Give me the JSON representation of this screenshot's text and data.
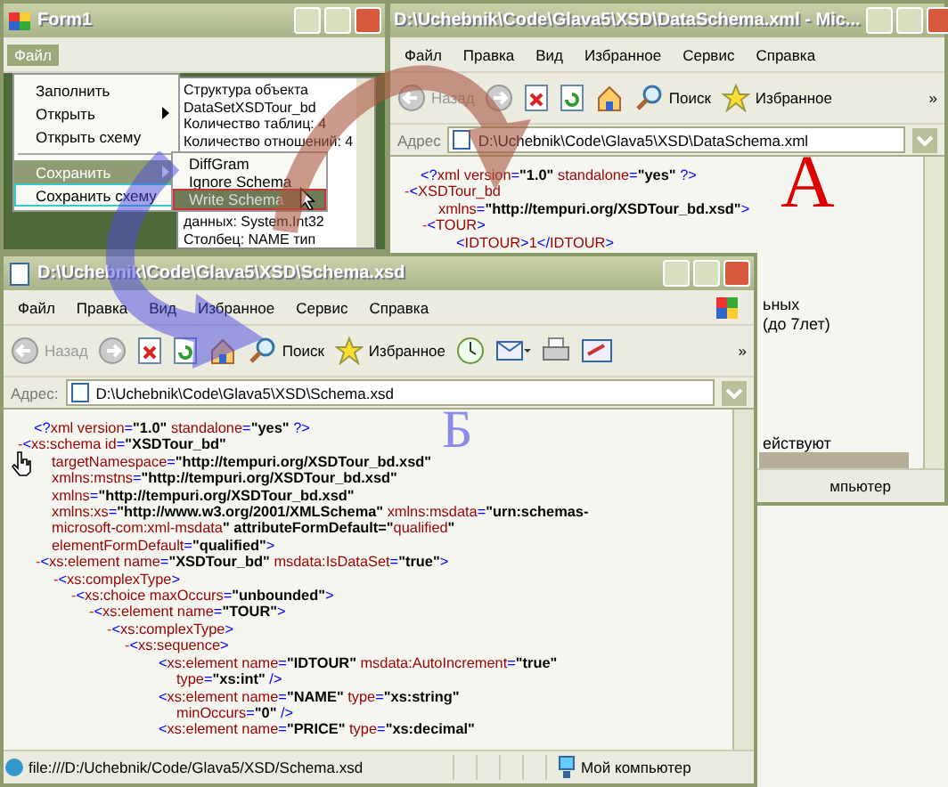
{
  "form1": {
    "title": "Form1",
    "menu": [
      {
        "label": "Файл",
        "selected": true
      }
    ],
    "dropdown": [
      {
        "label": "Заполнить",
        "selected": false,
        "submenu": false,
        "focused": false
      },
      {
        "label": "Открыть",
        "selected": false,
        "submenu": true,
        "focused": false
      },
      {
        "label": "Открыть схему",
        "selected": false,
        "submenu": false,
        "focused": false
      },
      {
        "label": "Сохранить",
        "selected": true,
        "submenu": true,
        "focused": false
      },
      {
        "label": "Сохранить схему",
        "selected": false,
        "submenu": false,
        "focused": true
      }
    ],
    "submenu": [
      {
        "label": "DiffGram",
        "selected": false
      },
      {
        "label": "Ignore Schema",
        "selected": false
      },
      {
        "label": "Write Schema",
        "selected": true
      }
    ],
    "textbox": [
      "Структура объекта",
      "DataSetXSDTour_bd",
      "Количество таблиц: 4",
      "Количество отношений: 4",
      "данных: System.Int32",
      "Столбец: NAME тип"
    ]
  },
  "window_a": {
    "title": "D:\\Uchebnik\\Code\\Glava5\\XSD\\DataSchema.xml - Mic...",
    "menu": [
      "Файл",
      "Правка",
      "Вид",
      "Избранное",
      "Сервис",
      "Справка"
    ],
    "toolbar": {
      "back": "Назад",
      "search": "Поиск",
      "favorites": "Избранное",
      "more": "»"
    },
    "address_label": "Адрес",
    "address": "D:\\Uchebnik\\Code\\Glava5\\XSD\\DataSchema.xml",
    "xml": [
      {
        "lines": [
          "<?xml version=\"1.0\" standalone=\"yes\" ?>"
        ]
      },
      {
        "toggle": "-",
        "lines": [
          "<XSDTour_bd",
          "xmlns=\"http://tempuri.org/XSDTour_bd.xsd\">"
        ],
        "children": [
          {
            "toggle": "-",
            "lines": [
              "<TOUR>"
            ],
            "children": [
              {
                "lines": [
                  "<IDTOUR>1</IDTOUR>"
                ]
              }
            ]
          }
        ]
      }
    ],
    "fragments": [
      "ьных",
      "(до 7лет)",
      "ействуют"
    ],
    "status": "мпьютер",
    "marker": "А"
  },
  "window_b": {
    "title": "D:\\Uchebnik\\Code\\Glava5\\XSD\\Schema.xsd",
    "menu": [
      "Файл",
      "Правка",
      "Вид",
      "Избранное",
      "Сервис",
      "Справка"
    ],
    "toolbar": {
      "back": "Назад",
      "search": "Поиск",
      "favorites": "Избранное",
      "more": "»"
    },
    "address_label": "Адрес:",
    "address": "D:\\Uchebnik\\Code\\Glava5\\XSD\\Schema.xsd",
    "xml": [
      {
        "lines": [
          "<?xml version=\"1.0\" standalone=\"yes\" ?>"
        ]
      },
      {
        "toggle": "-",
        "lines": [
          "<xs:schema id=\"XSDTour_bd\"",
          "targetNamespace=\"http://tempuri.org/XSDTour_bd.xsd\"",
          "xmlns:mstns=\"http://tempuri.org/XSDTour_bd.xsd\"",
          "xmlns=\"http://tempuri.org/XSDTour_bd.xsd\"",
          "xmlns:xs=\"http://www.w3.org/2001/XMLSchema\" xmlns:msdata=\"urn:schemas-",
          "microsoft-com:xml-msdata\" attributeFormDefault=\"qualified\"",
          "elementFormDefault=\"qualified\">"
        ],
        "children": [
          {
            "toggle": "-",
            "lines": [
              "<xs:element name=\"XSDTour_bd\" msdata:IsDataSet=\"true\">"
            ],
            "children": [
              {
                "toggle": "-",
                "lines": [
                  "<xs:complexType>"
                ],
                "children": [
                  {
                    "toggle": "-",
                    "lines": [
                      "<xs:choice maxOccurs=\"unbounded\">"
                    ],
                    "children": [
                      {
                        "toggle": "-",
                        "lines": [
                          "<xs:element name=\"TOUR\">"
                        ],
                        "children": [
                          {
                            "toggle": "-",
                            "lines": [
                              "<xs:complexType>"
                            ],
                            "children": [
                              {
                                "toggle": "-",
                                "lines": [
                                  "<xs:sequence>"
                                ],
                                "children": [
                                  {
                                    "lines": [
                                      "<xs:element name=\"IDTOUR\" msdata:AutoIncrement=\"true\"",
                                      "type=\"xs:int\" />"
                                    ]
                                  },
                                  {
                                    "lines": [
                                      "<xs:element name=\"NAME\" type=\"xs:string\"",
                                      "minOccurs=\"0\" />"
                                    ]
                                  },
                                  {
                                    "lines": [
                                      "<xs:element name=\"PRICE\" type=\"xs:decimal\""
                                    ]
                                  }
                                ]
                              }
                            ]
                          }
                        ]
                      }
                    ]
                  }
                ]
              }
            ]
          }
        ]
      }
    ],
    "status": "file:///D:/Uchebnik/Code/Glava5/XSD/Schema.xsd",
    "zone": "Мой компьютер",
    "marker": "Б"
  }
}
